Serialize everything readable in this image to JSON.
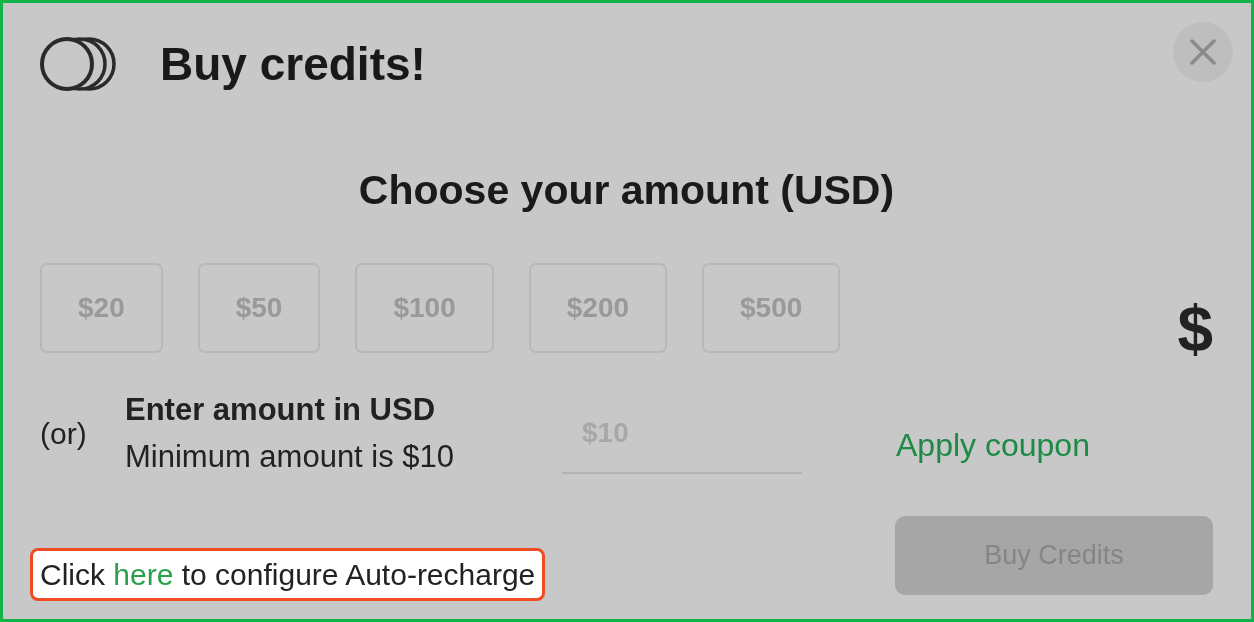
{
  "header": {
    "title": "Buy credits!"
  },
  "amount_picker": {
    "heading": "Choose your amount (USD)",
    "options": [
      {
        "label": "$20",
        "selected": false
      },
      {
        "label": "$50",
        "selected": false
      },
      {
        "label": "$100",
        "selected": false
      },
      {
        "label": "$200",
        "selected": false
      },
      {
        "label": "$500",
        "selected": false
      }
    ],
    "currency_symbol": "$"
  },
  "custom_amount": {
    "separator": "(or)",
    "label": "Enter amount in USD",
    "hint": "Minimum amount is $10",
    "input": {
      "placeholder": "$10"
    },
    "coupon_link": "Apply coupon"
  },
  "footer": {
    "auto_recharge": {
      "text_before": "Click",
      "link": "here",
      "text_after": "to configure Auto-recharge"
    },
    "buy_button": {
      "label": "Buy Credits",
      "disabled": true
    }
  }
}
